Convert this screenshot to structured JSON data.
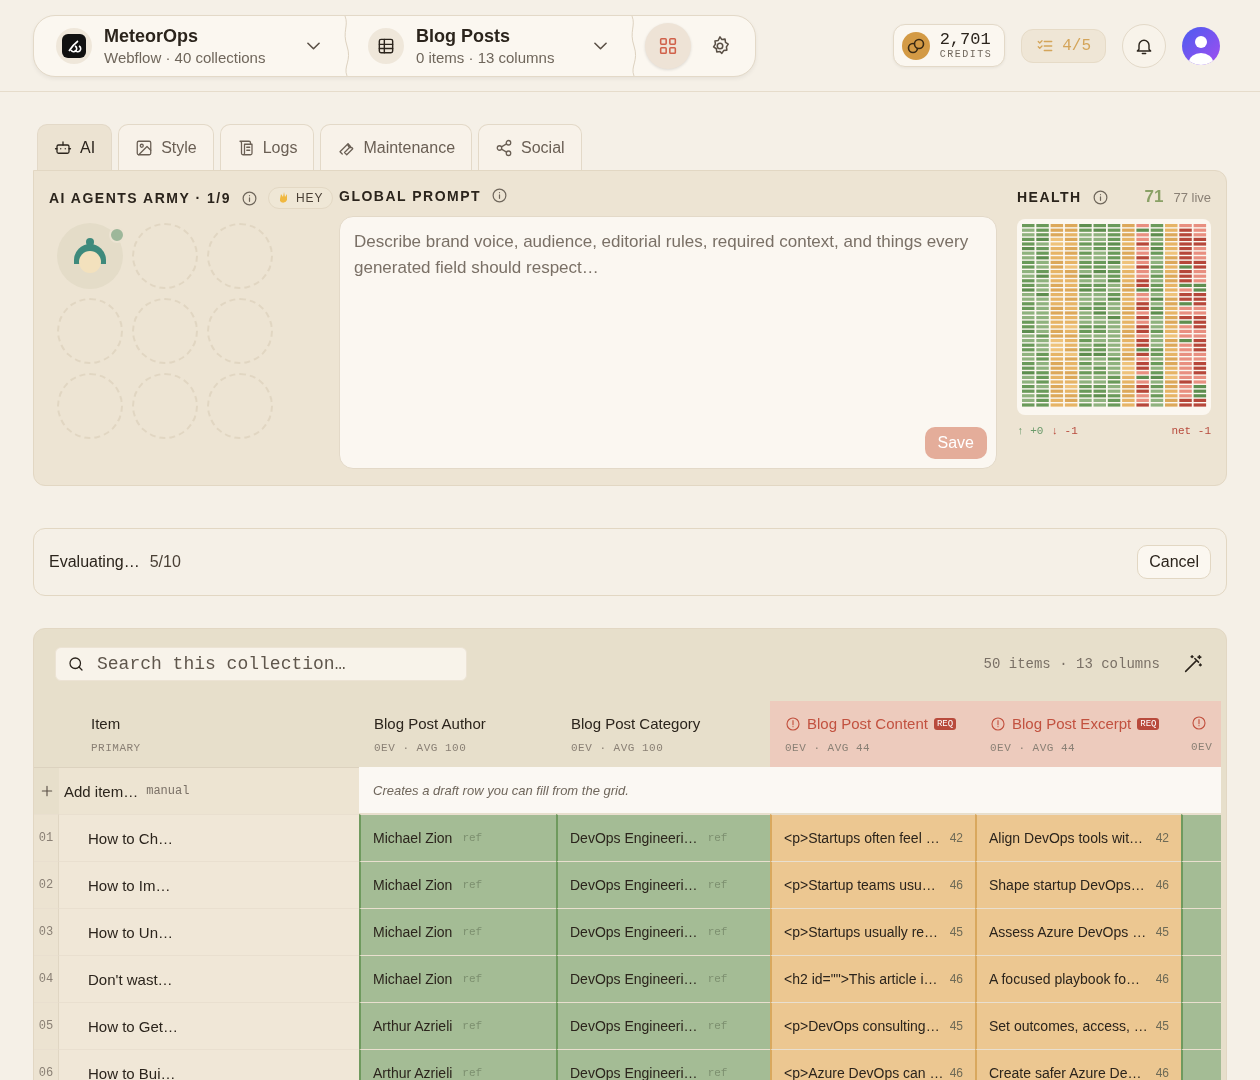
{
  "topbar": {
    "workspace": {
      "name": "MeteorOps",
      "subtitle": "Webflow · 40 collections"
    },
    "collection": {
      "name": "Blog Posts",
      "subtitle": "0 items · 13 columns"
    },
    "tool_buttons": [
      {
        "kind": "grid",
        "selected": true
      },
      {
        "kind": "settings",
        "selected": false
      }
    ],
    "credits": {
      "value": "2,701",
      "label": "CREDITS"
    },
    "tasks": "4/5"
  },
  "tabs": [
    {
      "label": "AI",
      "selected": true
    },
    {
      "label": "Style",
      "selected": false
    },
    {
      "label": "Logs",
      "selected": false
    },
    {
      "label": "Maintenance",
      "selected": false
    },
    {
      "label": "Social",
      "selected": false
    }
  ],
  "agents": {
    "title": "AI AGENTS ARMY · 1/9",
    "greeting": "HEY",
    "slots": [
      {
        "filled": true
      },
      {
        "filled": false
      },
      {
        "filled": false
      },
      {
        "filled": false
      },
      {
        "filled": false
      },
      {
        "filled": false
      },
      {
        "filled": false
      },
      {
        "filled": false
      },
      {
        "filled": false
      }
    ]
  },
  "prompt": {
    "title": "GLOBAL PROMPT",
    "placeholder": "Describe brand voice, audience, editorial rules, required context, and things every generated field should respect…",
    "save": "Save"
  },
  "health": {
    "title": "HEALTH",
    "score": "71",
    "live": "77 live",
    "up": "↑ +0",
    "down": "↓ -1",
    "net": "net -1"
  },
  "progress": {
    "label": "Evaluating…",
    "count": "5/10",
    "cancel": "Cancel"
  },
  "table": {
    "search": {
      "placeholder": "Search this collection…"
    },
    "summary": "50 items · 13 columns",
    "columns": [
      {
        "title": "Item",
        "meta": "PRIMARY",
        "alert": false,
        "kind": "primary"
      },
      {
        "title": "Blog Post Author",
        "meta": "0EV · AVG 100",
        "alert": false,
        "kind": "good"
      },
      {
        "title": "Blog Post Category",
        "meta": "0EV · AVG 100",
        "alert": false,
        "kind": "good"
      },
      {
        "title": "Blog Post Content",
        "meta": "0EV · AVG 44",
        "alert": true,
        "required": "REQ",
        "kind": "fair"
      },
      {
        "title": "Blog Post Excerpt",
        "meta": "0EV · AVG 44",
        "alert": true,
        "required": "REQ",
        "kind": "fair"
      },
      {
        "meta": "0EV",
        "alert": true,
        "kind": "good"
      }
    ],
    "add_row": {
      "label": "Add item…",
      "tag": "manual",
      "hint": "Creates a draft row you can fill from the grid."
    },
    "rows": [
      {
        "number": "01",
        "cells": [
          {
            "text": "How to Ch…"
          },
          {
            "text": "Michael Zion",
            "note": "ref"
          },
          {
            "text": "DevOps Engineeri…",
            "note": "ref"
          },
          {
            "text": "<p>Startups often feel …",
            "note": "42"
          },
          {
            "text": "Align DevOps tools wit…",
            "note": "42"
          }
        ]
      },
      {
        "number": "02",
        "cells": [
          {
            "text": "How to Im…"
          },
          {
            "text": "Michael Zion",
            "note": "ref"
          },
          {
            "text": "DevOps Engineeri…",
            "note": "ref"
          },
          {
            "text": "<p>Startup teams usu…",
            "note": "46"
          },
          {
            "text": "Shape startup DevOps…",
            "note": "46"
          }
        ]
      },
      {
        "number": "03",
        "cells": [
          {
            "text": "How to Un…"
          },
          {
            "text": "Michael Zion",
            "note": "ref"
          },
          {
            "text": "DevOps Engineeri…",
            "note": "ref"
          },
          {
            "text": "<p>Startups usually re…",
            "note": "45"
          },
          {
            "text": "Assess Azure DevOps …",
            "note": "45"
          }
        ]
      },
      {
        "number": "04",
        "cells": [
          {
            "text": "Don't wast…"
          },
          {
            "text": "Michael Zion",
            "note": "ref"
          },
          {
            "text": "DevOps Engineeri…",
            "note": "ref"
          },
          {
            "text": "<h2 id=\"\">This article i…",
            "note": "46"
          },
          {
            "text": "A focused playbook fo…",
            "note": "46"
          }
        ]
      },
      {
        "number": "05",
        "cells": [
          {
            "text": "How to Get…"
          },
          {
            "text": "Arthur Azrieli",
            "note": "ref"
          },
          {
            "text": "DevOps Engineeri…",
            "note": "ref"
          },
          {
            "text": "<p>DevOps consulting…",
            "note": "45"
          },
          {
            "text": "Set outcomes, access, …",
            "note": "45"
          }
        ]
      },
      {
        "number": "06",
        "cells": [
          {
            "text": "How to Bui…"
          },
          {
            "text": "Arthur Azrieli",
            "note": "ref"
          },
          {
            "text": "DevOps Engineeri…",
            "note": "ref"
          },
          {
            "text": "<p>Azure DevOps can …",
            "note": "46"
          },
          {
            "text": "Create safer Azure De…",
            "note": "46"
          }
        ]
      }
    ]
  }
}
